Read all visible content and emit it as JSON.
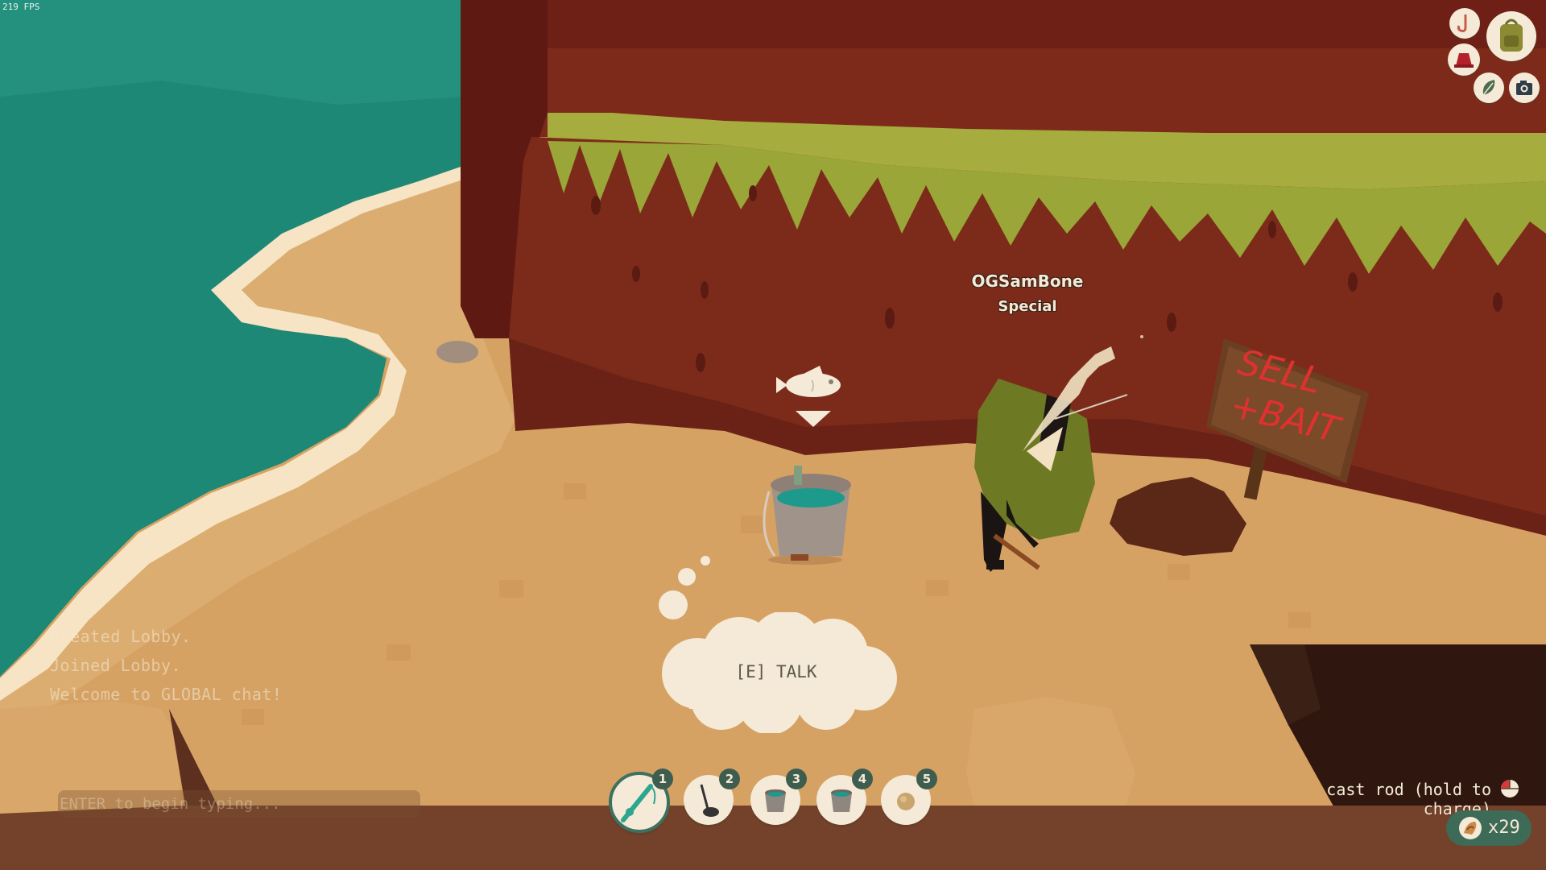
{
  "hud": {
    "fps": "219 FPS",
    "player": {
      "name": "OGSamBone",
      "title": "Special"
    },
    "chat": {
      "messages": [
        "Created Lobby.",
        "Joined Lobby.",
        "Welcome to GLOBAL chat!"
      ],
      "input_placeholder": "ENTER to begin typing..."
    },
    "interaction_prompt": "[E] TALK",
    "action_hint": "cast rod (hold to charge)",
    "bait_count": "x29"
  },
  "hotbar": {
    "selected_slot": 1,
    "slots": [
      {
        "number": "1",
        "icon": "fishing-rod-icon"
      },
      {
        "number": "2",
        "icon": "metal-detector-icon"
      },
      {
        "number": "3",
        "icon": "bucket-icon"
      },
      {
        "number": "4",
        "icon": "bucket-icon"
      },
      {
        "number": "5",
        "icon": "bait-icon"
      }
    ]
  },
  "menu": {
    "buttons": [
      "hook-icon",
      "backpack-icon",
      "hat-icon",
      "leaf-icon",
      "camera-icon"
    ]
  },
  "world": {
    "sign_text": "SELL + BAIT",
    "npc_marker": "fish-icon"
  },
  "colors": {
    "sea": "#1f8a78",
    "sand": "#d6a264",
    "cliff": "#7b2a1a",
    "grass": "#9aa637",
    "ui_cream": "#f4ead7",
    "ui_green": "#3e6a58",
    "sign_text": "#e03030"
  }
}
